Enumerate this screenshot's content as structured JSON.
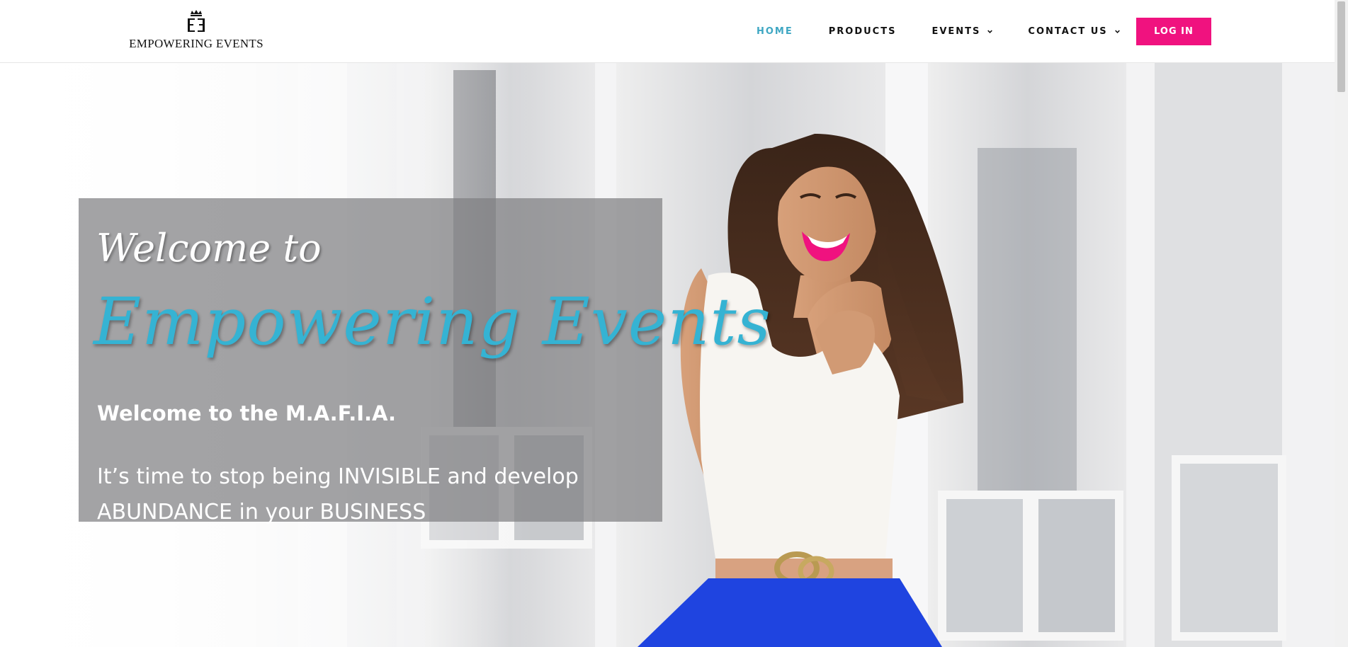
{
  "header": {
    "logo_text": "EMPOWERING EVENTS",
    "nav": [
      {
        "label": "HOME",
        "active": true
      },
      {
        "label": "PRODUCTS"
      },
      {
        "label": "EVENTS",
        "dropdown": true
      },
      {
        "label": "CONTACT US",
        "dropdown": true
      }
    ],
    "login_label": "LOG IN"
  },
  "hero": {
    "welcome_to": "Welcome to",
    "brand_title": "Empowering Events",
    "subheading": "Welcome to the M.A.F.I.A.",
    "tagline": "It’s time to stop being INVISIBLE and  develop ABUNDANCE in your BUSINESS"
  },
  "colors": {
    "accent_teal": "#3fa7c3",
    "login_pink": "#f0127f",
    "brand_blue": "#35b3d3",
    "skirt_blue": "#1f44e0",
    "lipstick": "#f0127f"
  },
  "icons": {
    "logo": "crown-monogram-icon",
    "dropdown": "chevron-down-icon"
  }
}
